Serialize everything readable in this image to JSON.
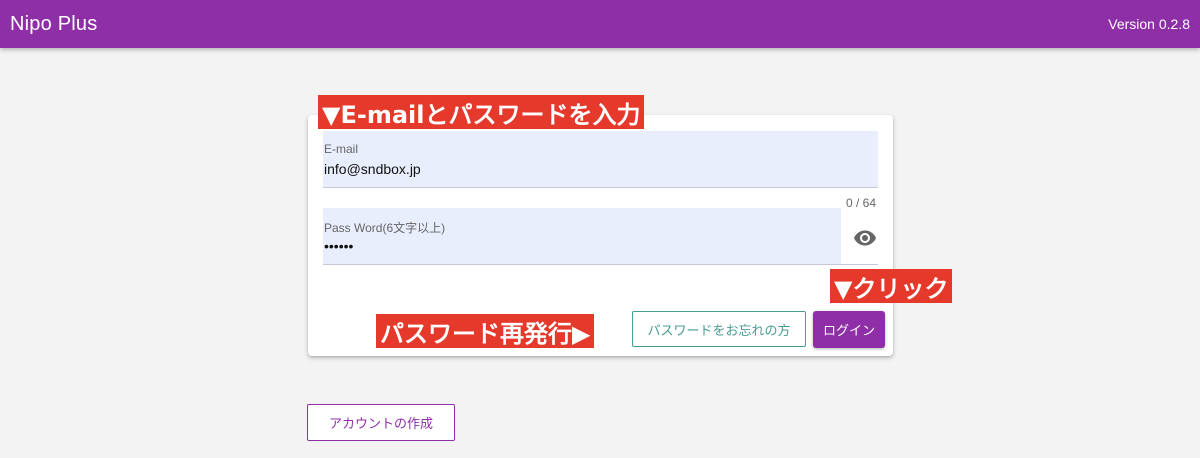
{
  "appbar": {
    "title": "Nipo Plus",
    "version": "Version 0.2.8"
  },
  "login_form": {
    "email": {
      "label": "E-mail",
      "value": "info@sndbox.jp"
    },
    "password": {
      "label": "Pass Word(6文字以上)",
      "value": "••••••",
      "counter": "0 / 64",
      "toggle_icon": "eye-icon"
    },
    "forgot_button_label": "パスワードをお忘れの方",
    "login_button_label": "ログイン"
  },
  "create_account_button_label": "アカウントの作成",
  "annotations": {
    "enter_credentials": "▼E-mailとパスワードを入力",
    "click": "▼クリック",
    "reissue_password": "パスワード再発行▶"
  },
  "colors": {
    "primary": "#8e2fa8",
    "teal": "#4a9c92",
    "annotation": "#e5392b",
    "field_bg": "#e8eefc",
    "page_bg": "#f3f3f3"
  }
}
